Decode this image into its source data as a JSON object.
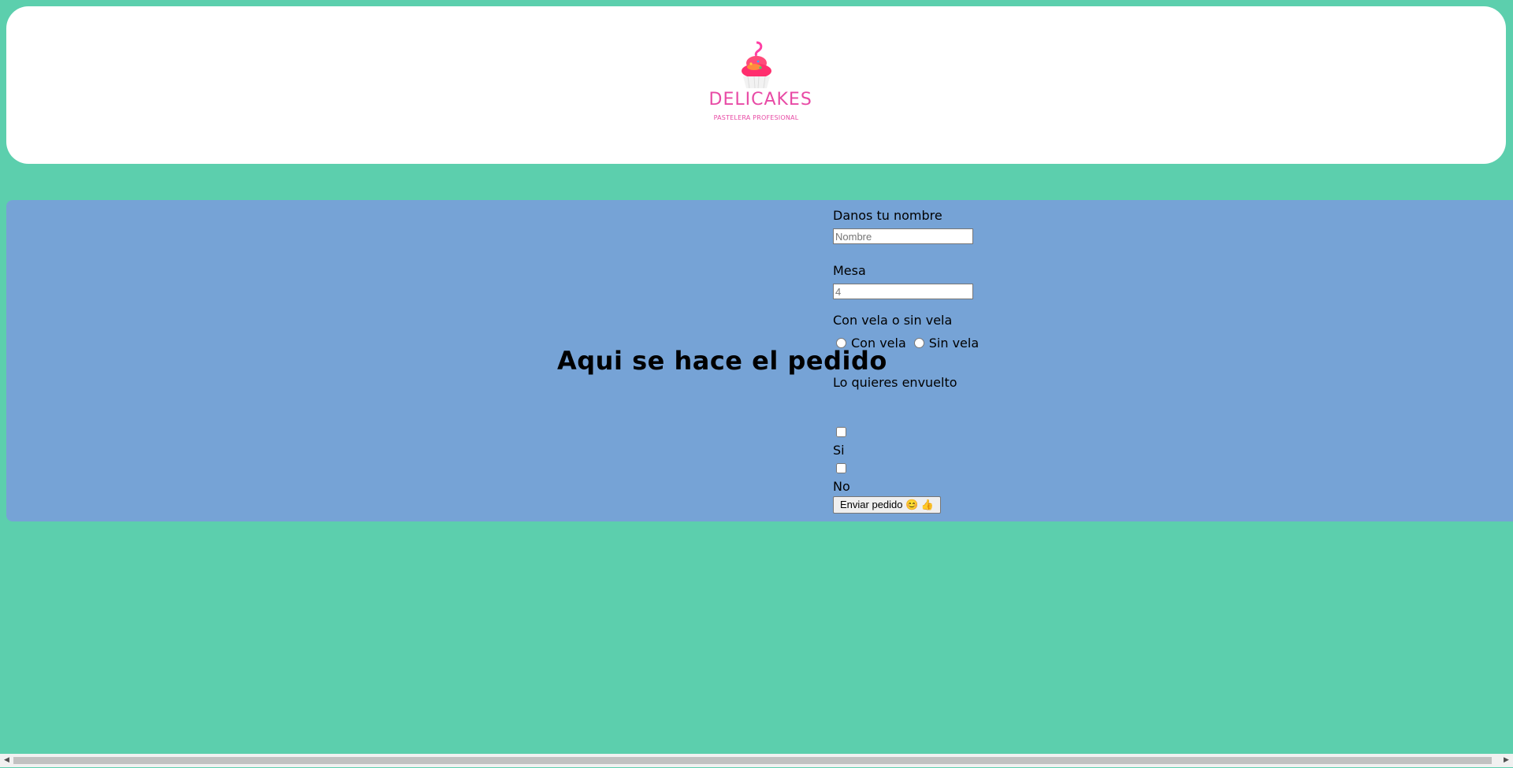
{
  "header": {
    "logo_name": "DELICAKES",
    "logo_tagline": "PASTELERA PROFESIONAL"
  },
  "order": {
    "title": "Aqui se hace el pedido",
    "name_label": "Danos tu nombre",
    "name_placeholder": "Nombre",
    "table_label": "Mesa",
    "table_placeholder": "4",
    "candle_label": "Con vela o sin vela",
    "candle_options": [
      "Con vela",
      "Sin vela"
    ],
    "wrap_label": "Lo quieres envuelto",
    "wrap_options": [
      "Si",
      "No"
    ],
    "submit_label": "Enviar pedido 😊 👍"
  },
  "colors": {
    "page_bg": "#5ccfad",
    "header_bg": "#ffffff",
    "section_bg": "#76a3d6",
    "brand_pink": "#e84aa5"
  },
  "icons": {
    "logo": "cupcake-icon",
    "scroll_left": "arrow-left-icon",
    "scroll_right": "arrow-right-icon"
  }
}
